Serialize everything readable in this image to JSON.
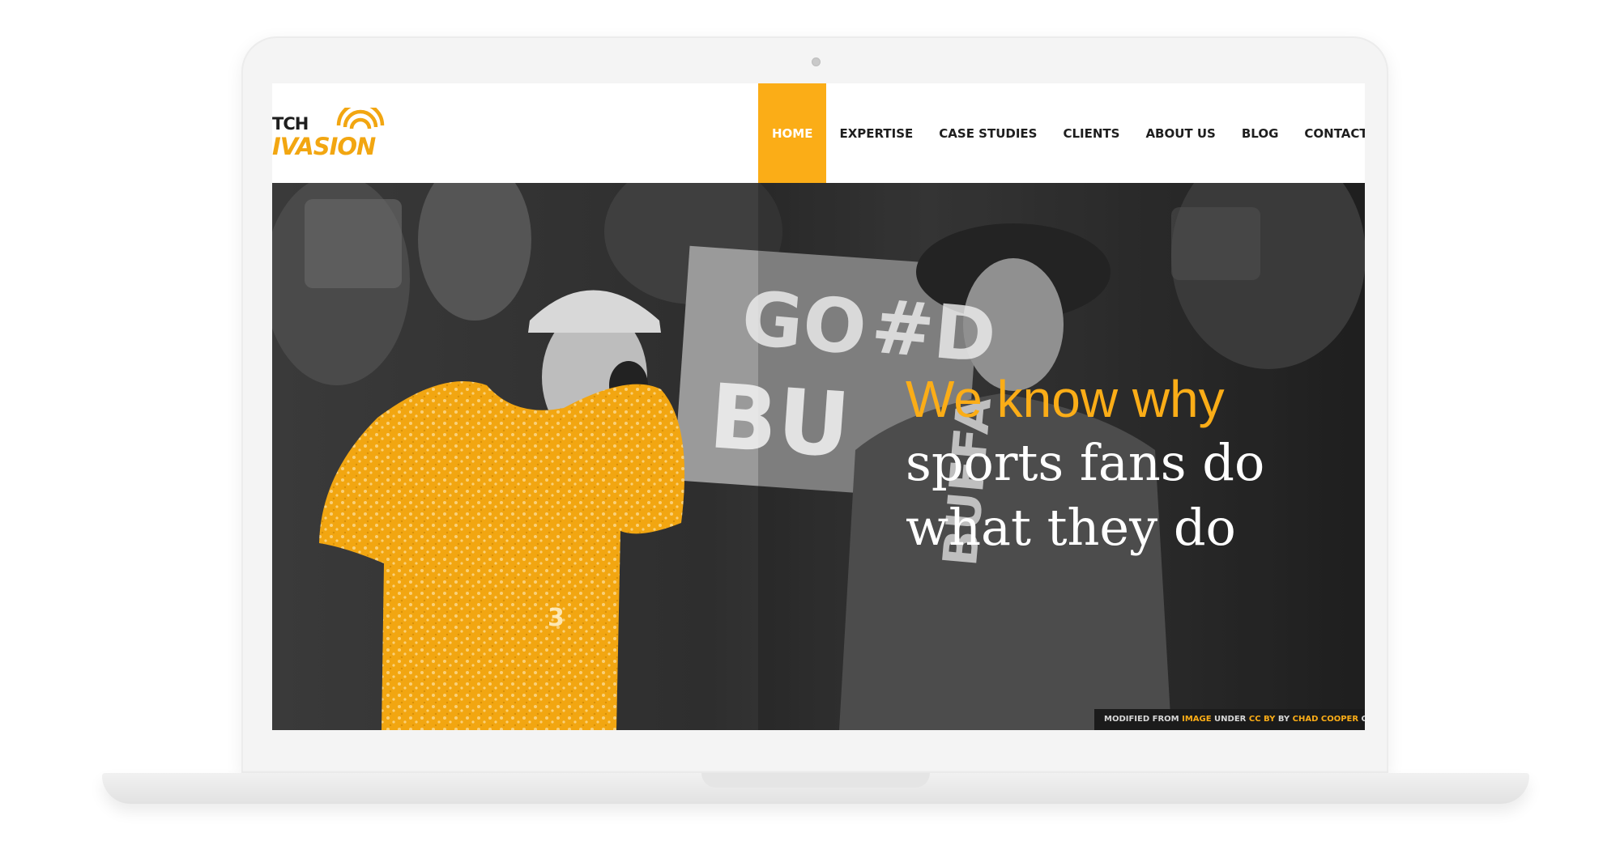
{
  "logo": {
    "line1": "TCH",
    "line2": "IVASION"
  },
  "nav": {
    "items": [
      {
        "label": "HOME",
        "active": true
      },
      {
        "label": "EXPERTISE",
        "active": false
      },
      {
        "label": "CASE STUDIES",
        "active": false
      },
      {
        "label": "CLIENTS",
        "active": false
      },
      {
        "label": "ABOUT US",
        "active": false
      },
      {
        "label": "BLOG",
        "active": false
      },
      {
        "label": "CONTACT US",
        "active": false
      }
    ]
  },
  "hero": {
    "headline_accent": "We know why",
    "headline_line2": "sports fans do",
    "headline_line3": "what they do",
    "sign_text_1": "GO",
    "sign_text_2": "#D",
    "sign_text_3": "BU",
    "shirt_text": "BUFFA",
    "jersey_number": "3",
    "credit": {
      "prefix": "MODIFIED FROM ",
      "image_link": "IMAGE",
      "middle": " UNDER ",
      "license_link": "CC BY",
      "by": " BY ",
      "author_link": "CHAD COOPER",
      "suffix": " C"
    }
  },
  "colors": {
    "accent": "#fbad17",
    "header_bg": "#ffffff",
    "hero_text": "#ffffff",
    "nav_text": "#1e1e1e"
  }
}
